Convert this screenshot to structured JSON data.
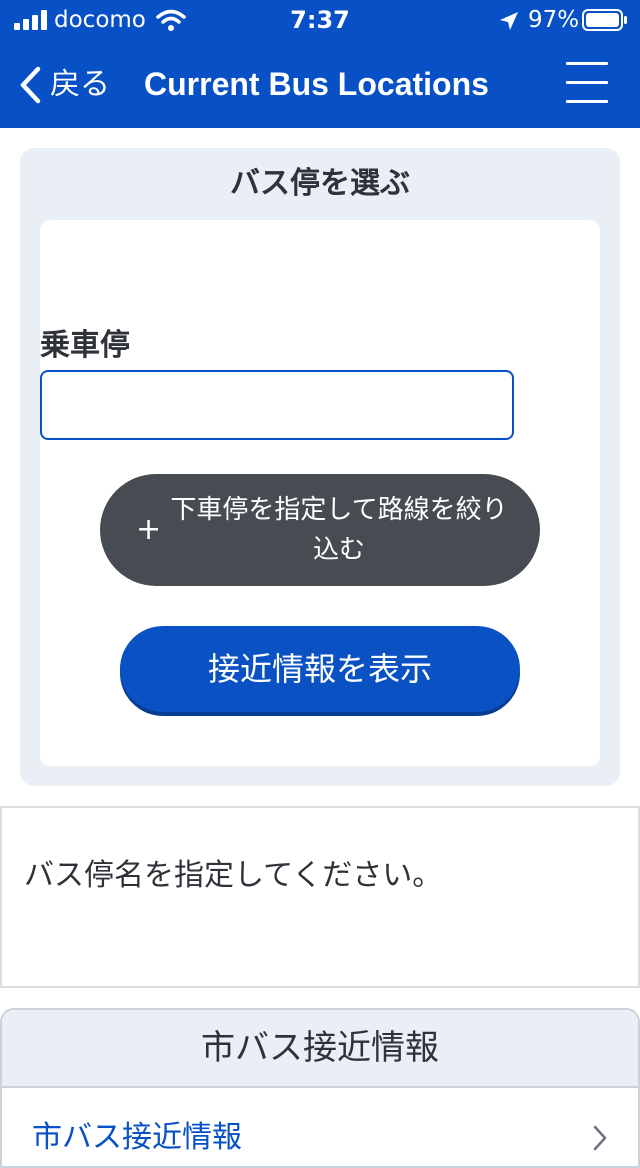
{
  "status_bar": {
    "carrier": "docomo",
    "time": "7:37",
    "battery_percent": "97%",
    "icons": [
      "signal-icon",
      "wifi-icon",
      "location-arrow-icon",
      "battery-icon"
    ]
  },
  "nav": {
    "back_label": "戻る",
    "title": "Current Bus Locations",
    "icons": [
      "chevron-left-icon",
      "hamburger-menu-icon"
    ]
  },
  "select_panel": {
    "title": "バス停を選ぶ",
    "boarding_label": "乗車停",
    "boarding_value": "",
    "filter_button_icon": "+",
    "filter_button_label": "下車停を指定して路線を絞り込む",
    "show_button_label": "接近情報を表示"
  },
  "message": {
    "text": "バス停名を指定してください。"
  },
  "city_bus_info": {
    "title": "市バス接近情報",
    "link_label": "市バス接近情報"
  },
  "colors": {
    "brand_blue": "#0750c5",
    "dark_button": "#474b52",
    "panel_bg": "#e9eff5",
    "text": "#2f3238"
  }
}
